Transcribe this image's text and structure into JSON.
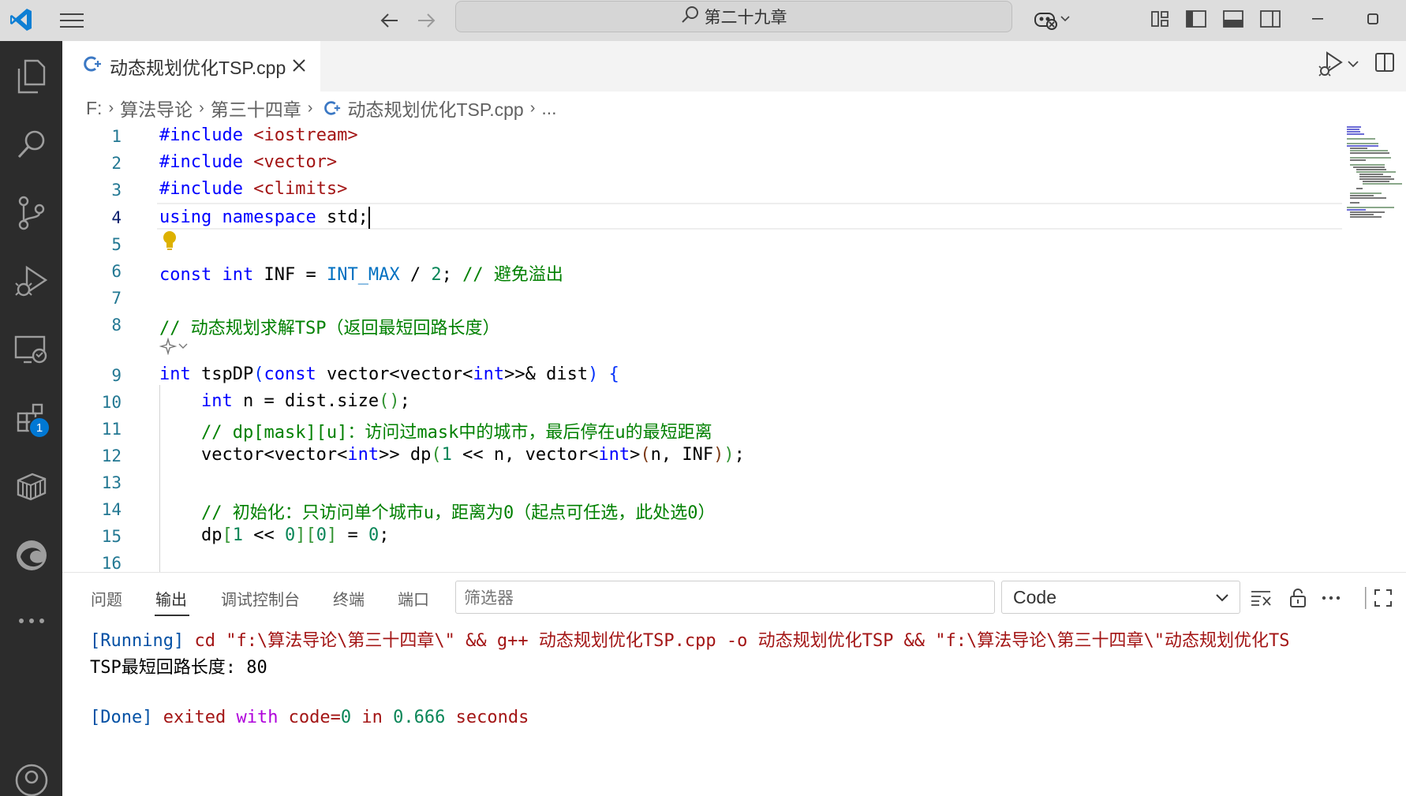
{
  "titlebar": {
    "search_text": "第二十九章",
    "icons": [
      "vscode-logo-icon",
      "menu-icon",
      "back-arrow-icon",
      "forward-arrow-icon",
      "search-icon",
      "copilot-icon",
      "customize-layout-icon",
      "toggle-sidebar-icon",
      "toggle-panel-icon",
      "toggle-secondary-sidebar-icon",
      "minimize-icon",
      "maximize-icon"
    ]
  },
  "activity_bar": {
    "items": [
      "explorer-icon",
      "search-icon",
      "source-control-icon",
      "run-debug-icon",
      "remote-explorer-icon",
      "extensions-icon",
      "containers-icon",
      "edge-devtools-icon",
      "more-icon",
      "accounts-icon"
    ],
    "extensions_badge": "1"
  },
  "tab": {
    "filename": "动态规划优化TSP.cpp",
    "file_icon": "C++"
  },
  "breadcrumb": {
    "items": [
      "F:",
      "算法导论",
      "第三十四章",
      "动态规划优化TSP.cpp",
      "..."
    ]
  },
  "editor": {
    "line_numbers": [
      "1",
      "2",
      "3",
      "4",
      "5",
      "6",
      "7",
      "8",
      "9",
      "10",
      "11",
      "12",
      "13",
      "14",
      "15",
      "16"
    ],
    "active_line": "4",
    "lines": [
      [
        "#include",
        " ",
        "<iostream>"
      ],
      [
        "#include",
        " ",
        "<vector>"
      ],
      [
        "#include",
        " ",
        "<climits>"
      ],
      [
        "using",
        " ",
        "namespace",
        " std;"
      ],
      [],
      [
        "const",
        " ",
        "int",
        " INF = ",
        "INT_MAX",
        " / ",
        "2",
        "; ",
        "// 避免溢出"
      ],
      [],
      [
        "// 动态规划求解TSP（返回最短回路长度）"
      ],
      [
        "int",
        " tspDP",
        "(",
        "const",
        " vector<vector<",
        "int",
        ">>& dist",
        ")",
        " ",
        "{"
      ],
      [
        "    ",
        "int",
        " n = dist.size",
        "()",
        ";"
      ],
      [
        "    ",
        "// dp[mask][u]：访问过mask中的城市，最后停在u的最短距离"
      ],
      [
        "    vector<vector<",
        "int",
        ">> dp",
        "(",
        "1",
        " << n, vector<",
        "int",
        ">",
        "(",
        "n, INF",
        ")",
        ")",
        ";"
      ],
      [],
      [
        "    ",
        "// 初始化：只访问单个城市u，距离为0（起点可任选，此处选0）"
      ],
      [
        "    dp",
        "[",
        "1",
        " << ",
        "0",
        "]",
        "[",
        "0",
        "]",
        " = ",
        "0",
        ";"
      ],
      []
    ]
  },
  "panel": {
    "tabs": [
      "问题",
      "输出",
      "调试控制台",
      "终端",
      "端口"
    ],
    "active_tab": "输出",
    "filter_placeholder": "筛选器",
    "channel": "Code",
    "output": {
      "line1_tag": "[Running]",
      "line1_cmd": " cd \"f:\\算法导论\\第三十四章\\\" && g++ 动态规划优化TSP.cpp -o 动态规划优化TSP && \"f:\\算法导论\\第三十四章\\\"动态规划优化TS",
      "line2": "TSP最短回路长度: 80",
      "line3_tag": "[Done]",
      "line3_a": " exited ",
      "line3_b": "with",
      "line3_c": " code=",
      "line3_d": "0",
      "line3_e": " in ",
      "line3_f": "0.666",
      "line3_g": " seconds"
    }
  },
  "colors": {
    "keyword": "#0000ff",
    "comment": "#008000",
    "number": "#098658",
    "activity_bar": "#2c2c2c",
    "badge": "#0078d4"
  }
}
